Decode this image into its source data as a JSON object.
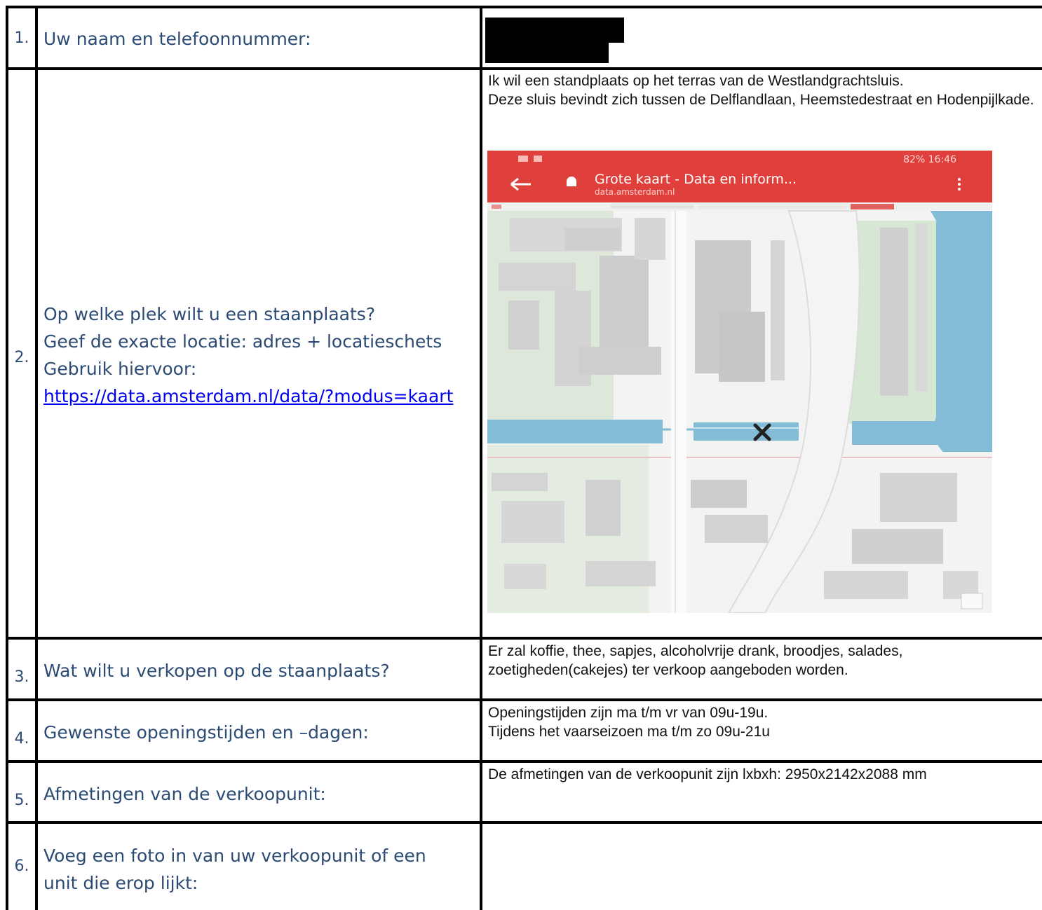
{
  "rows": [
    {
      "number": "1.",
      "question": "Uw naam en telefoonnummer:",
      "answer": ""
    },
    {
      "number": "2.",
      "question_lines": [
        "Op welke plek wilt u een staanplaats?",
        "Geef de exacte locatie: adres + locatieschets",
        "Gebruik hiervoor:"
      ],
      "link": "https://data.amsterdam.nl/data/?modus=kaart",
      "answer": "Ik wil een standplaats op het terras van de Westlandgrachtsluis.\nDeze sluis bevindt zich tussen de Delflandlaan, Heemstedestraat en Hodenpijlkade."
    },
    {
      "number": "3.",
      "question": "Wat wilt u verkopen op de staanplaats?",
      "answer": "Er zal koffie, thee, sapjes, alcoholvrije drank, broodjes, salades, zoetigheden(cakejes) ter verkoop aangeboden worden."
    },
    {
      "number": "4.",
      "question": "Gewenste openingstijden en –dagen:",
      "answer": "Openingstijden zijn ma t/m vr van 09u-19u.\nTijdens het vaarseizoen ma t/m zo 09u-21u"
    },
    {
      "number": "5.",
      "question": "Afmetingen van de verkoopunit:",
      "answer": "De afmetingen van de verkoopunit zijn lxbxh: 2950x2142x2088 mm"
    },
    {
      "number": "6.",
      "question_lines": [
        "Voeg een foto in van uw verkoopunit of een",
        "unit die erop lijkt:"
      ],
      "answer": ""
    }
  ],
  "map_screenshot": {
    "status_bar": "82% 16:46",
    "title": "Grote kaart - Data en inform...",
    "url": "data.amsterdam.nl",
    "back_icon": "arrow-left-icon",
    "lock_icon": "lock-icon",
    "menu_icon": "kebab-menu-icon",
    "marker_icon": "x-marker-icon",
    "colors": {
      "header": "#e0403c",
      "water": "#82bcd6",
      "building": "#d4d4d4",
      "green": "#dbe9d8",
      "road": "#f6f6f6"
    }
  }
}
